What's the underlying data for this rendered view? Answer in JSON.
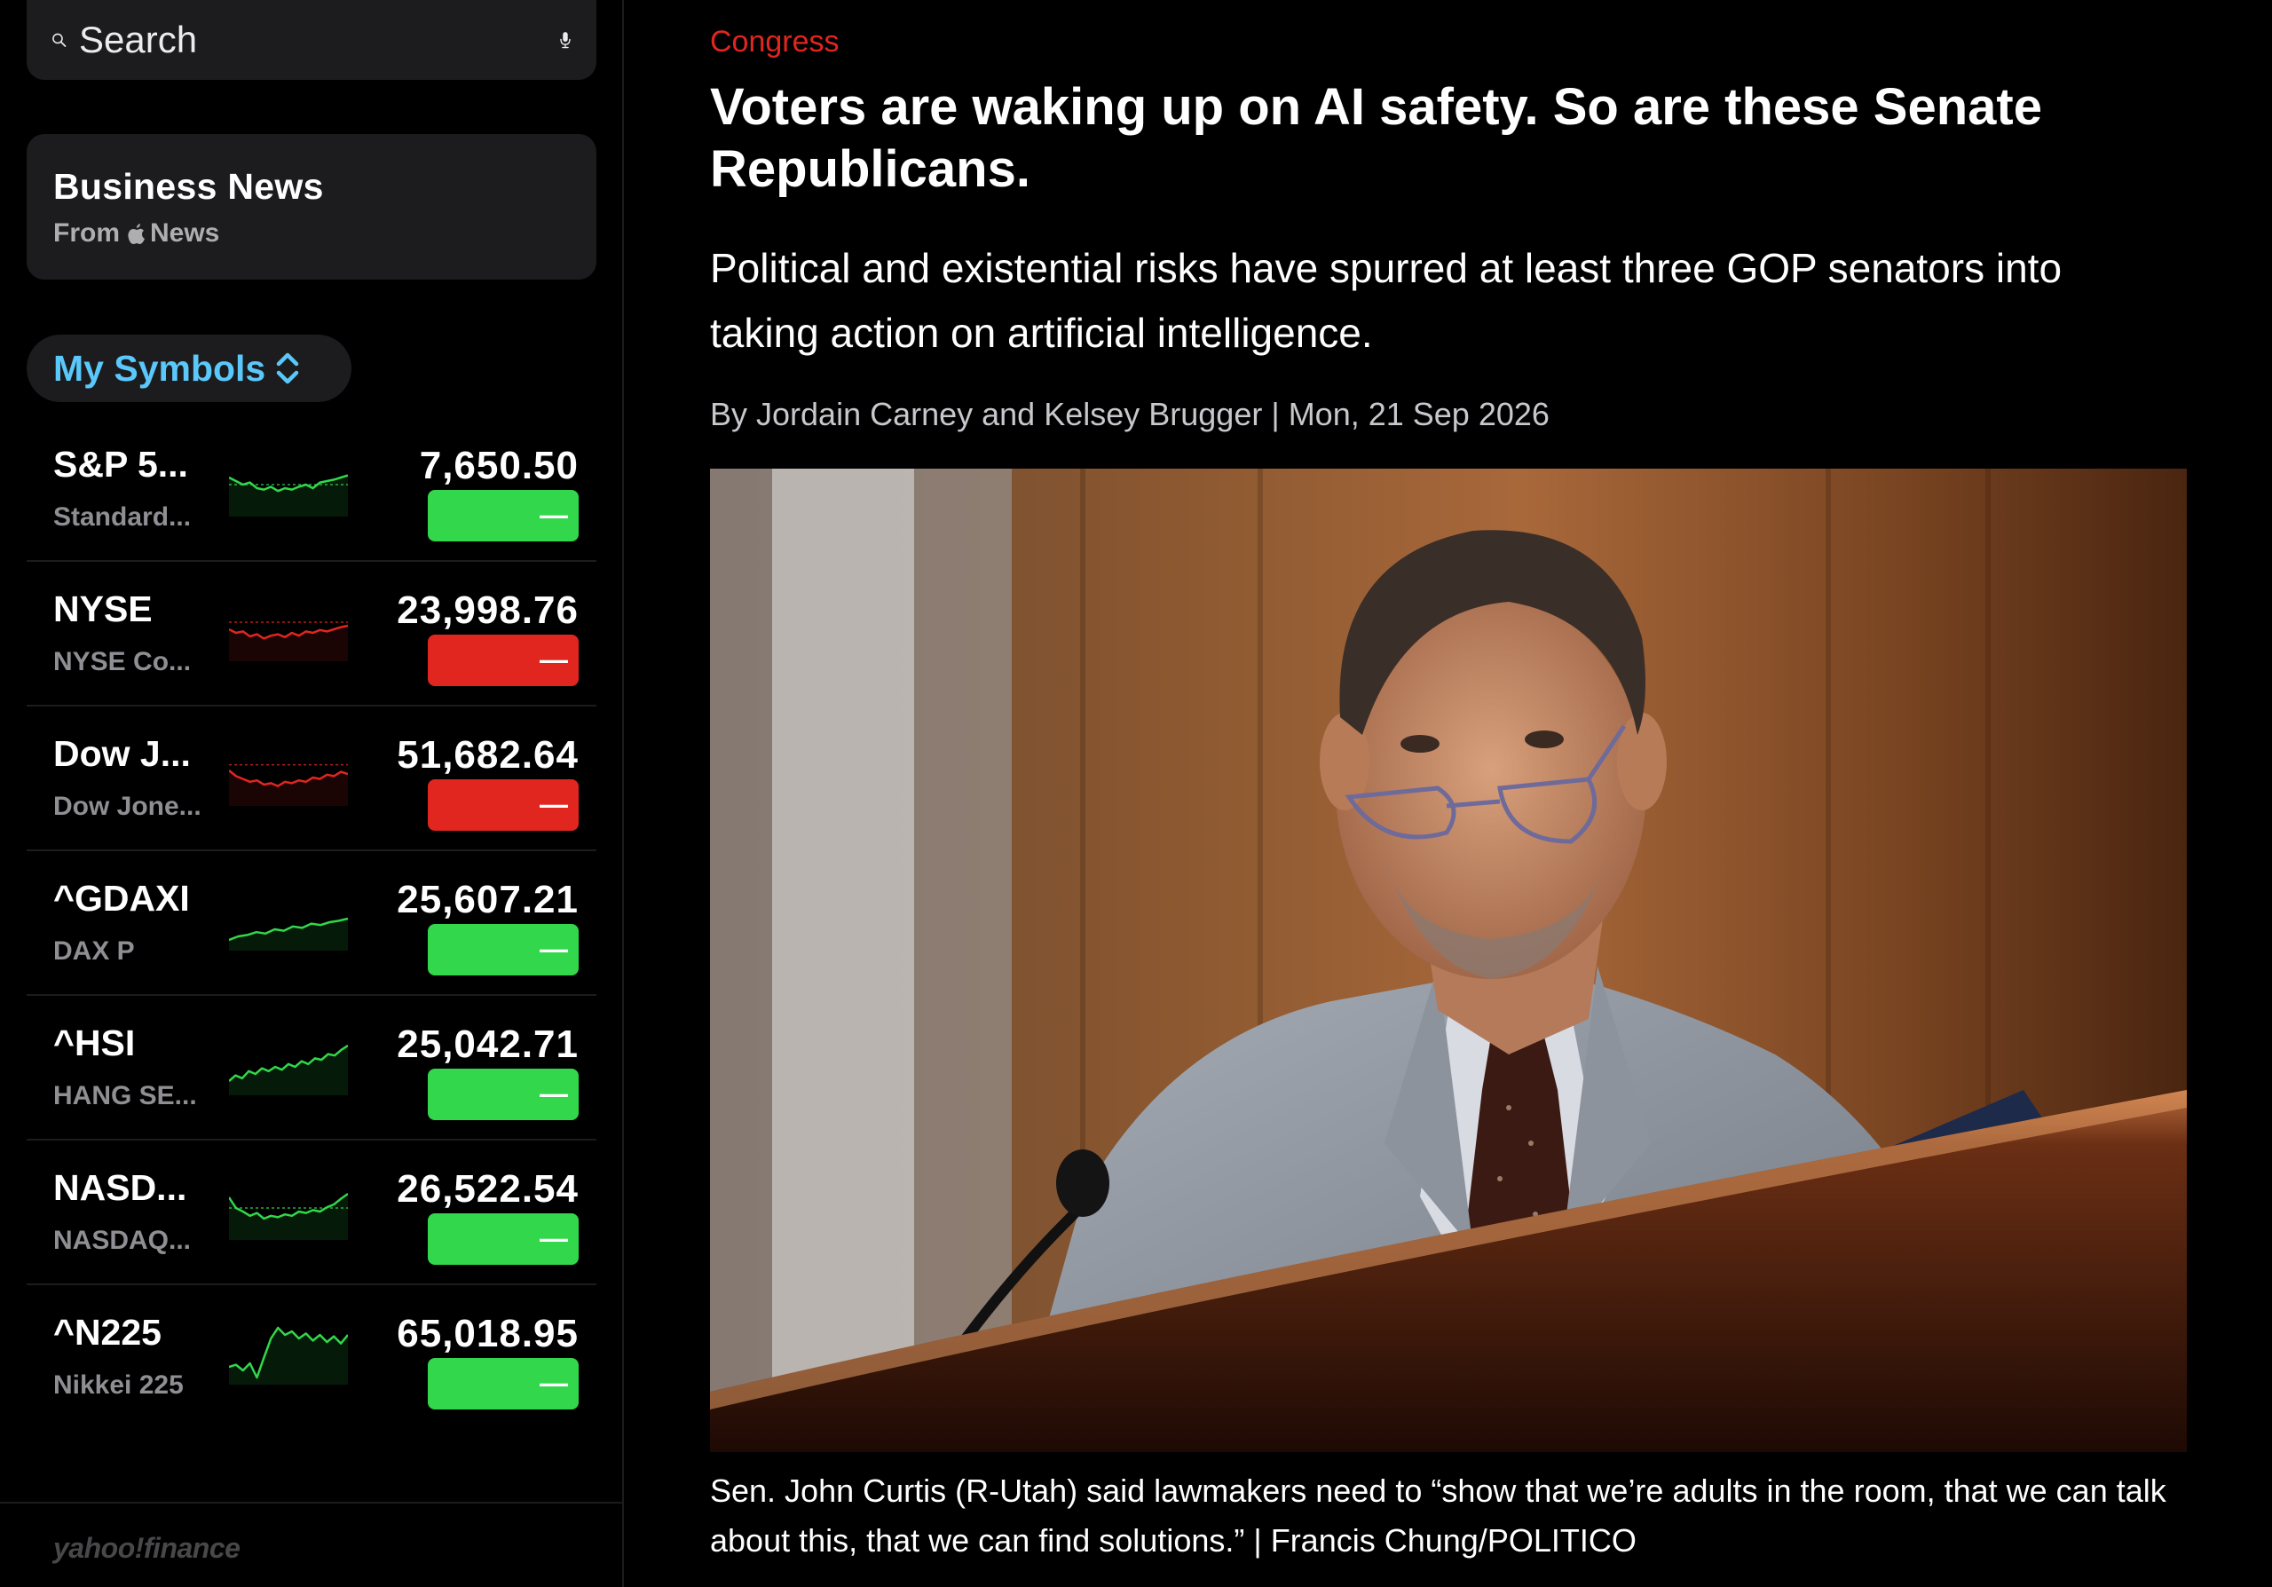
{
  "search": {
    "placeholder": "Search"
  },
  "news_card": {
    "title": "Business News",
    "from_prefix": "From",
    "from_suffix": "News"
  },
  "symbols_header": {
    "label": "My Symbols"
  },
  "colors": {
    "up": "#32d74b",
    "down": "#e0261f",
    "accent": "#5ac8fa"
  },
  "symbols": [
    {
      "ticker": "S&P 5...",
      "name": "Standard...",
      "price": "7,650.50",
      "change": "—",
      "direction": "up",
      "spark": [
        0.45,
        0.5,
        0.55,
        0.52,
        0.6,
        0.62,
        0.58,
        0.64,
        0.6,
        0.62,
        0.58,
        0.55,
        0.6,
        0.52,
        0.5,
        0.48,
        0.45,
        0.42
      ],
      "baseline": 0.55
    },
    {
      "ticker": "NYSE",
      "name": "NYSE Co...",
      "price": "23,998.76",
      "change": "—",
      "direction": "down",
      "spark": [
        0.55,
        0.6,
        0.58,
        0.65,
        0.62,
        0.68,
        0.64,
        0.62,
        0.66,
        0.6,
        0.64,
        0.58,
        0.6,
        0.56,
        0.58,
        0.55,
        0.52,
        0.5
      ],
      "baseline": 0.45
    },
    {
      "ticker": "Dow J...",
      "name": "Dow Jone...",
      "price": "51,682.64",
      "change": "—",
      "direction": "down",
      "spark": [
        0.5,
        0.58,
        0.62,
        0.66,
        0.64,
        0.7,
        0.68,
        0.72,
        0.66,
        0.68,
        0.64,
        0.66,
        0.6,
        0.62,
        0.56,
        0.58,
        0.52,
        0.55
      ],
      "baseline": 0.42
    },
    {
      "ticker": "^GDAXI",
      "name": "DAX P",
      "price": "25,607.21",
      "change": "—",
      "direction": "up",
      "spark": [
        0.85,
        0.8,
        0.78,
        0.74,
        0.76,
        0.7,
        0.72,
        0.66,
        0.68,
        0.62,
        0.64,
        0.6,
        0.58,
        0.55
      ],
      "baseline": null
    },
    {
      "ticker": "^HSI",
      "name": "HANG SE...",
      "price": "25,042.71",
      "change": "—",
      "direction": "up",
      "spark": [
        0.8,
        0.72,
        0.76,
        0.66,
        0.7,
        0.62,
        0.66,
        0.6,
        0.64,
        0.56,
        0.6,
        0.52,
        0.56,
        0.48,
        0.5,
        0.42,
        0.44,
        0.36,
        0.3
      ],
      "baseline": null
    },
    {
      "ticker": "NASD...",
      "name": "NASDAQ...",
      "price": "26,522.54",
      "change": "—",
      "direction": "up",
      "spark": [
        0.4,
        0.55,
        0.6,
        0.66,
        0.62,
        0.7,
        0.66,
        0.68,
        0.64,
        0.66,
        0.6,
        0.62,
        0.58,
        0.6,
        0.54,
        0.5,
        0.42,
        0.35
      ],
      "baseline": 0.55
    },
    {
      "ticker": "^N225",
      "name": "Nikkei 225",
      "price": "65,018.95",
      "change": "—",
      "direction": "up",
      "spark": [
        0.75,
        0.72,
        0.8,
        0.7,
        0.9,
        0.62,
        0.35,
        0.2,
        0.3,
        0.25,
        0.35,
        0.28,
        0.38,
        0.3,
        0.4,
        0.32,
        0.42,
        0.3
      ],
      "baseline": null
    }
  ],
  "footer": {
    "logo_text": "yahoo!finance"
  },
  "article": {
    "category": "Congress",
    "headline": "Voters are waking up on AI safety. So are these Senate Republicans.",
    "subhead": "Political and existential risks have spurred at least three GOP senators into taking action on artificial intelligence.",
    "byline": "By Jordain Carney and Kelsey Brugger | Mon, 21 Sep 2026",
    "caption": "Sen. John Curtis (R-Utah) said lawmakers need to “show that we’re adults in the room, that we can talk about this, that we can find solutions.” | Francis Chung/POLITICO"
  }
}
